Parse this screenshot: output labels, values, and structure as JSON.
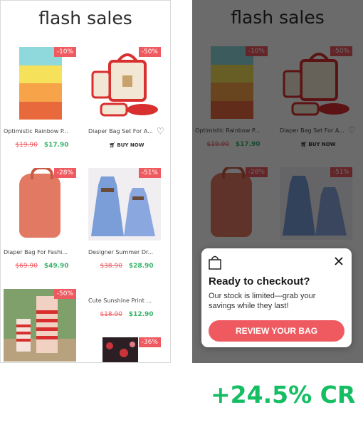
{
  "title": "flash sales",
  "products": [
    {
      "name": "Optimistic Rainbow P...",
      "discount": "-10%",
      "old_price": "$19.90",
      "new_price": "$17.90",
      "image": "rainbow-canvas-print"
    },
    {
      "name": "Diaper Bag Set For A...",
      "discount": "-50%",
      "action": "BUY NOW",
      "image": "red-diaper-bag-set",
      "wishlist_icon": "heart-icon",
      "action_icon": "cart-icon"
    },
    {
      "name": "Diaper Bag For Fashi...",
      "discount": "-28%",
      "old_price": "$69.90",
      "new_price": "$49.90",
      "image": "coral-diaper-backpack"
    },
    {
      "name": "Designer Summer Dr...",
      "discount": "-51%",
      "old_price": "$38.90",
      "new_price": "$28.90",
      "image": "blue-gingham-dresses"
    },
    {
      "name": "",
      "discount": "-50%",
      "image": "striped-mother-daughter-dresses"
    },
    {
      "name": "Cute Sunshine Print ...",
      "old_price": "$18.90",
      "new_price": "$12.90",
      "image": ""
    },
    {
      "name": "",
      "discount": "-36%",
      "image": "floral-outfit"
    }
  ],
  "popup": {
    "icon": "shopping-bag-icon",
    "close_icon": "close-icon",
    "title": "Ready to checkout?",
    "body": "Our stock is limited—grab your savings while they last!",
    "button_label": "REVIEW YOUR BAG",
    "accent_color": "#ef5a60"
  },
  "result_label": "+24.5% CR",
  "colors": {
    "badge": "#ef5a60",
    "sale_price": "#39b36b",
    "result": "#15bd63"
  }
}
